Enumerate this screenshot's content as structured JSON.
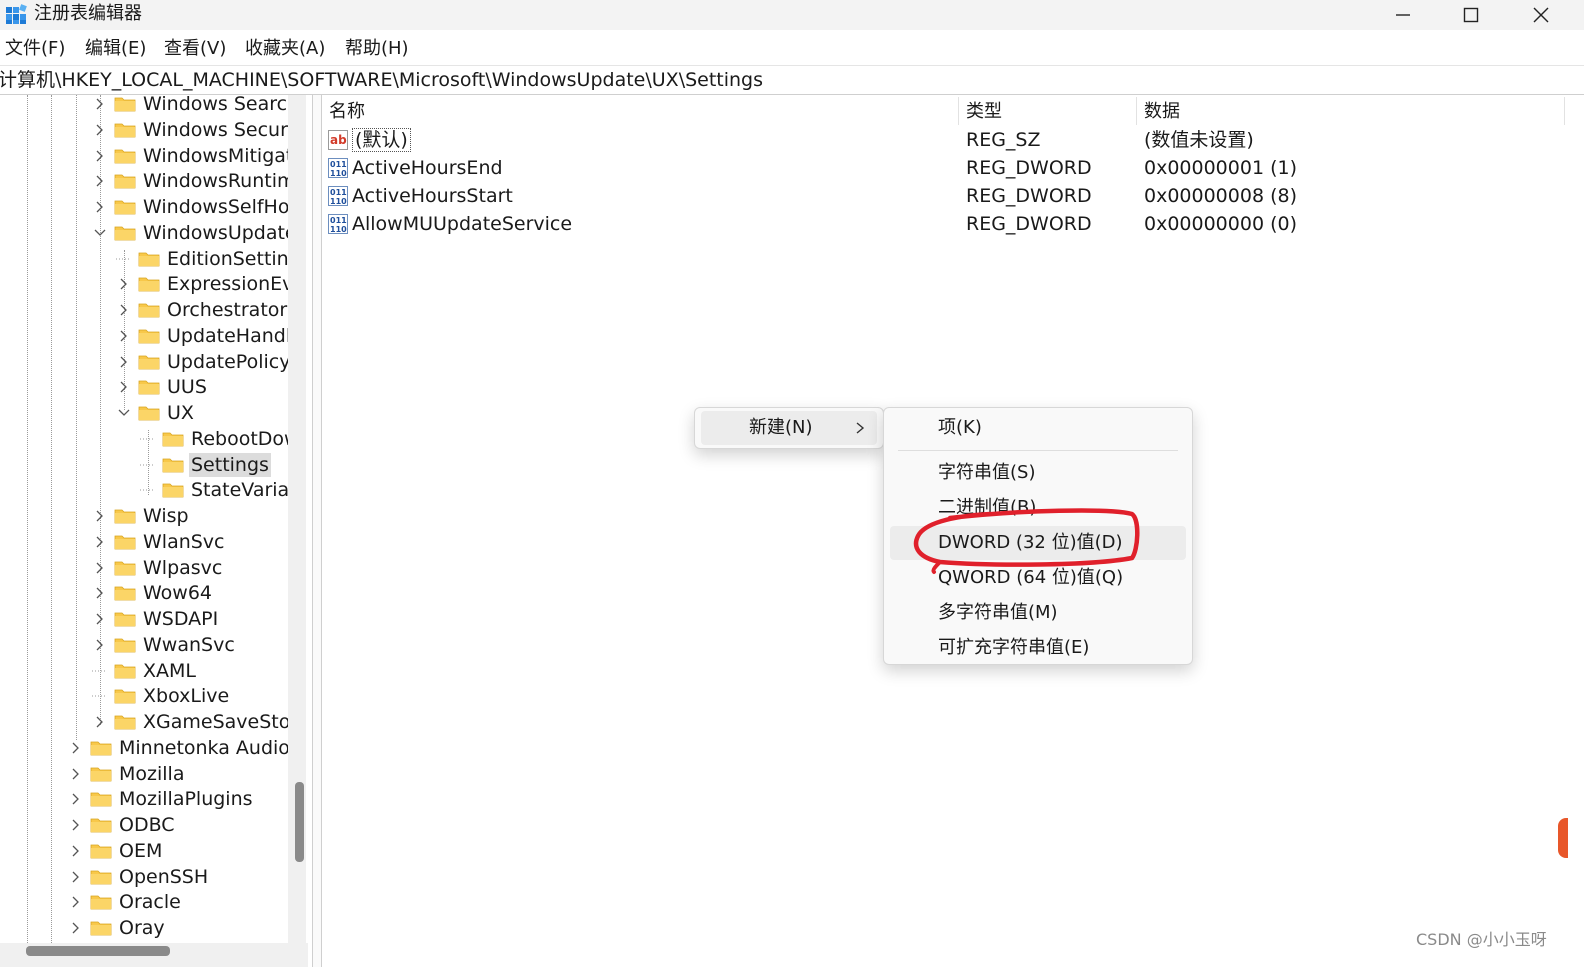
{
  "window": {
    "title": "注册表编辑器"
  },
  "menu": [
    "文件(F)",
    "编辑(E)",
    "查看(V)",
    "收藏夹(A)",
    "帮助(H)"
  ],
  "address": "计算机\\HKEY_LOCAL_MACHINE\\SOFTWARE\\Microsoft\\WindowsUpdate\\UX\\Settings",
  "tree": [
    "Windows Search",
    "Windows Security",
    "WindowsMitigati",
    "WindowsRuntime",
    "WindowsSelfHost",
    "WindowsUpdate",
    "EditionSettings",
    "ExpressionEval",
    "Orchestrator",
    "UpdateHandle",
    "UpdatePolicy",
    "UUS",
    "UX",
    "RebootDow",
    "Settings",
    "StateVariabl",
    "Wisp",
    "WlanSvc",
    "Wlpasvc",
    "Wow64",
    "WSDAPI",
    "WwanSvc",
    "XAML",
    "XboxLive",
    "XGameSaveStorag",
    "Minnetonka Audio S",
    "Mozilla",
    "MozillaPlugins",
    "ODBC",
    "OEM",
    "OpenSSH",
    "Oracle",
    "Oray"
  ],
  "columns": {
    "name": "名称",
    "type": "类型",
    "data": "数据"
  },
  "values": [
    {
      "name": "(默认)",
      "type": "REG_SZ",
      "data": "(数值未设置)",
      "icon": "string-value-icon"
    },
    {
      "name": "ActiveHoursEnd",
      "type": "REG_DWORD",
      "data": "0x00000001 (1)",
      "icon": "binary-value-icon"
    },
    {
      "name": "ActiveHoursStart",
      "type": "REG_DWORD",
      "data": "0x00000008 (8)",
      "icon": "binary-value-icon"
    },
    {
      "name": "AllowMUUpdateService",
      "type": "REG_DWORD",
      "data": "0x00000000 (0)",
      "icon": "binary-value-icon"
    }
  ],
  "context_menu": {
    "new_label": "新建(N)"
  },
  "submenu": [
    "项(K)",
    "字符串值(S)",
    "二进制值(B)",
    "DWORD (32 位)值(D)",
    "QWORD (64 位)值(Q)",
    "多字符串值(M)",
    "可扩充字符串值(E)"
  ],
  "watermark": "CSDN @小小玉呀",
  "colors": {
    "folder": "#f8c84a",
    "annotation": "#e0202b",
    "selection": "#dcdcdc"
  }
}
